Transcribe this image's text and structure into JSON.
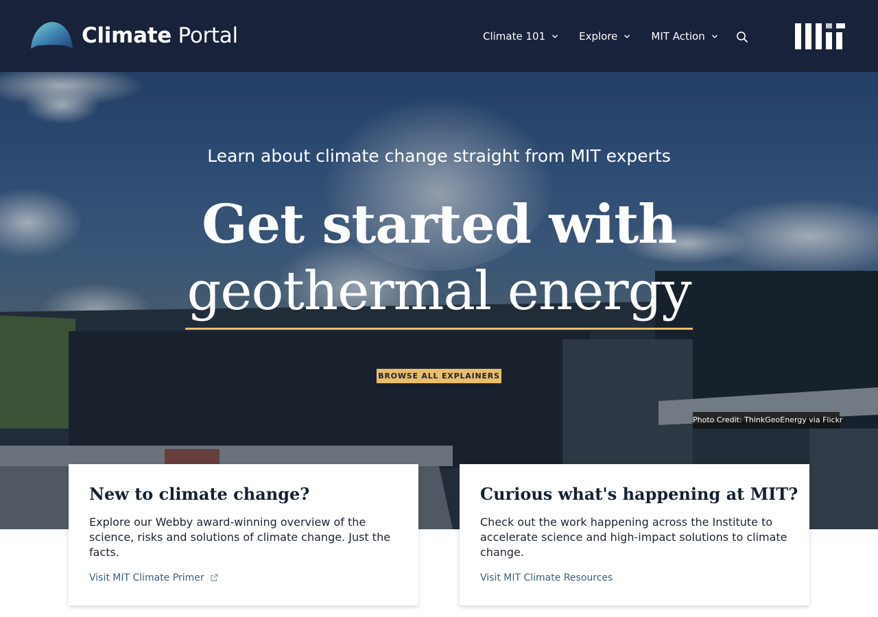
{
  "header": {
    "brand_bold": "Climate",
    "brand_light": "Portal",
    "nav": [
      {
        "label": "Climate 101",
        "icon": "chevron-down-icon"
      },
      {
        "label": "Explore",
        "icon": "chevron-down-icon"
      },
      {
        "label": "MIT Action",
        "icon": "chevron-down-icon"
      }
    ],
    "search_icon": "search-icon",
    "institution_logo": "MIT"
  },
  "hero": {
    "subtitle": "Learn about climate change straight from MIT experts",
    "title_line1": "Get started with",
    "title_line2": "geothermal energy",
    "button_label": "BROWSE ALL EXPLAINERS",
    "photo_credit": "Photo Credit: ThinkGeoEnergy via Flickr"
  },
  "cards": [
    {
      "title": "New to climate change?",
      "body": "Explore our Webby award-winning overview of the science, risks and solutions of climate change. Just the facts.",
      "link": "Visit MIT Climate Primer",
      "link_icon": "external-link-icon"
    },
    {
      "title": "Curious what's happening at MIT?",
      "body": "Check out the work happening across the Institute to accelerate science and high-impact solutions to climate change.",
      "link": "Visit MIT Climate Resources"
    }
  ],
  "colors": {
    "header_bg": "#18223a",
    "accent_gold": "#e9bd69",
    "link": "#3d5e79"
  }
}
